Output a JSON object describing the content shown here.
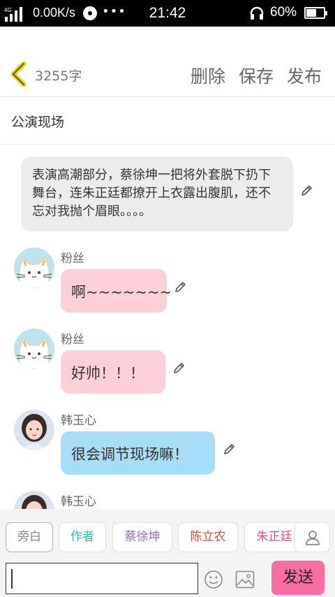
{
  "status_bar": {
    "network_label": "4G",
    "speed": "0.00K/s",
    "dots": "•••",
    "time": "21:42",
    "battery": "60%"
  },
  "header": {
    "word_count": "3255字",
    "delete_label": "删除",
    "save_label": "保存",
    "publish_label": "发布"
  },
  "title": "公演现场",
  "narration": "表演高潮部分，蔡徐坤一把将外套脱下扔下舞台，连朱正廷都撩开上衣露出腹肌，还不忘对我抛个眉眼。。。。",
  "messages": [
    {
      "sender": "粉丝",
      "text": "啊~~~~~~~",
      "avatar": "cat-avatar"
    },
    {
      "sender": "粉丝",
      "text": "好帅！！！",
      "avatar": "cat-avatar"
    },
    {
      "sender": "韩玉心",
      "text": "很会调节现场嘛！",
      "avatar": "girl-avatar"
    },
    {
      "sender": "韩玉心",
      "avatar": "girl-avatar"
    }
  ],
  "roles": [
    {
      "label": "旁白",
      "color": "#888888"
    },
    {
      "label": "作者",
      "color": "#2bbfb0"
    },
    {
      "label": "蔡徐坤",
      "color": "#a066c8"
    },
    {
      "label": "陈立农",
      "color": "#d94a3a"
    },
    {
      "label": "朱正廷",
      "color": "#e0508a"
    }
  ],
  "input": {
    "placeholder": "",
    "send_label": "发送"
  },
  "colors": {
    "accent_pink": "#f76fa0",
    "bubble_pink": "#fdcfd8",
    "bubble_blue": "#a8ddf8",
    "back_icon": "#f1d200"
  }
}
